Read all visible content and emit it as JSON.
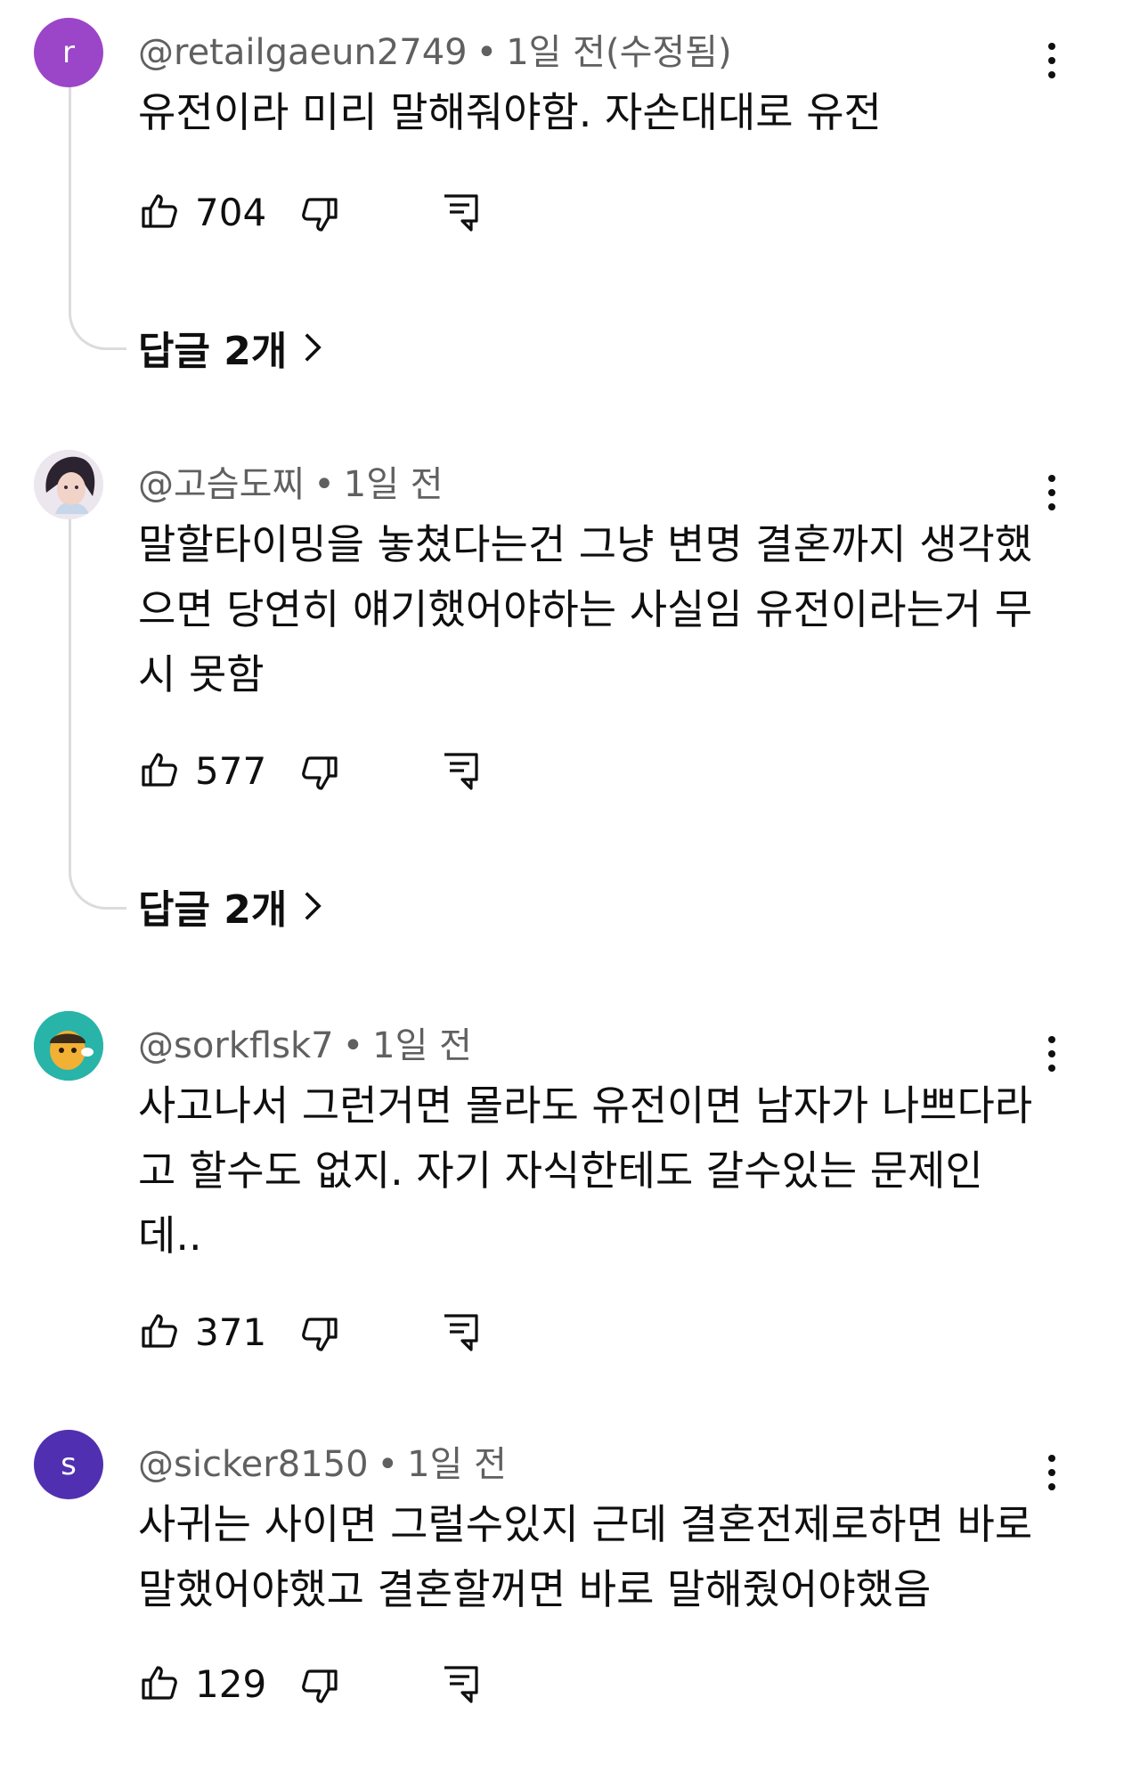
{
  "comments": [
    {
      "avatar_letter": "r",
      "avatar_color": "#9b45c9",
      "handle": "@retailgaeun2749",
      "separator": "•",
      "time": "1일 전(수정됨)",
      "text": "유전이라 미리 말해줘야함. 자손대대로 유전",
      "likes": "704",
      "replies_label": "답글 2개"
    },
    {
      "avatar_letter": "",
      "avatar_color": "#5a4a6e",
      "handle": "@고슴도찌",
      "separator": "•",
      "time": "1일 전",
      "text": "말할타이밍을 놓쳤다는건 그냥 변명    결혼까지 생각했으면 당연히 얘기했어야하는 사실임 유전이라는거 무시 못함",
      "likes": "577",
      "replies_label": "답글 2개"
    },
    {
      "avatar_letter": "",
      "avatar_color": "#28b4a8",
      "handle": "@sorkflsk7",
      "separator": "•",
      "time": "1일 전",
      "text": "사고나서 그런거면 몰라도 유전이면 남자가 나쁘다라고 할수도 없지. 자기 자식한테도 갈수있는 문제인데..",
      "likes": "371"
    },
    {
      "avatar_letter": "s",
      "avatar_color": "#5030b0",
      "handle": "@sicker8150",
      "separator": "•",
      "time": "1일 전",
      "text": "사귀는 사이면 그럴수있지 근데 결혼전제로하면 바로 말했어야했고 결혼할꺼면 바로 말해줬어야했음",
      "likes": "129"
    }
  ],
  "icons": {
    "like": "thumbs-up-icon",
    "dislike": "thumbs-down-icon",
    "reply": "reply-comment-icon",
    "more": "more-vertical-icon",
    "chevron": "chevron-right-icon"
  }
}
